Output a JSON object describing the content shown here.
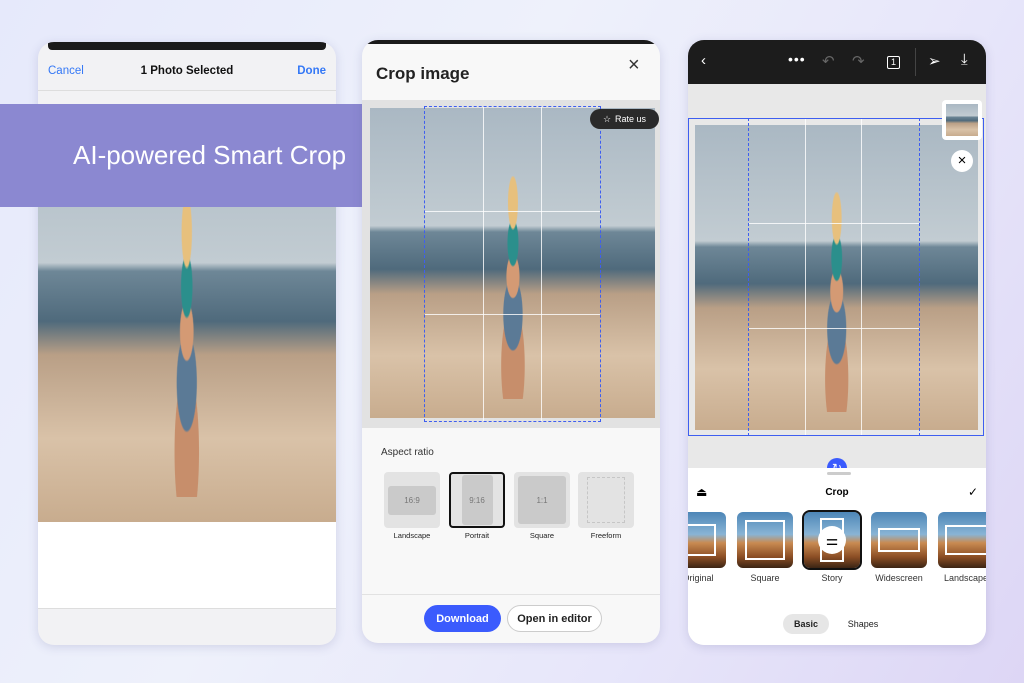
{
  "banner": {
    "title": "AI-powered Smart Crop"
  },
  "phone1": {
    "cancel": "Cancel",
    "title": "1 Photo Selected",
    "done": "Done"
  },
  "phone2": {
    "title": "Crop image",
    "close_icon": "close-icon",
    "rate_us": "Rate us",
    "aspect_label": "Aspect ratio",
    "ratios": [
      {
        "ratio": "16:9",
        "label": "Landscape"
      },
      {
        "ratio": "9:16",
        "label": "Portrait",
        "selected": true
      },
      {
        "ratio": "1:1",
        "label": "Square"
      },
      {
        "ratio": "",
        "label": "Freeform"
      }
    ],
    "download": "Download",
    "open_editor": "Open in editor"
  },
  "phone3": {
    "title": "Crop",
    "counter": "1",
    "presets": [
      {
        "label": "Original"
      },
      {
        "label": "Square"
      },
      {
        "label": "Story",
        "selected": true
      },
      {
        "label": "Widescreen"
      },
      {
        "label": "Landscape"
      }
    ],
    "tabs": [
      {
        "label": "Basic",
        "active": true
      },
      {
        "label": "Shapes"
      }
    ]
  },
  "colors": {
    "banner": "#8b88d1",
    "accent": "#3b5bfd",
    "crop": "#3e5ef0"
  }
}
